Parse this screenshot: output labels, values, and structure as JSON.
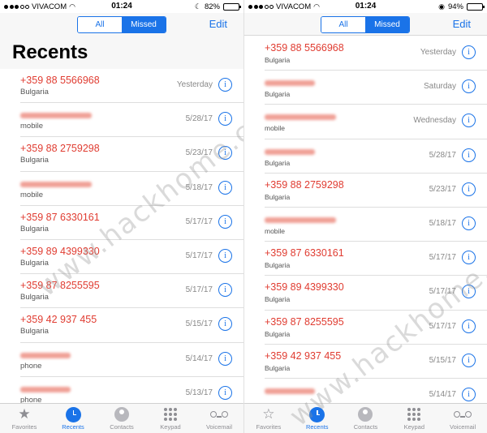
{
  "left": {
    "status": {
      "carrier": "VIVACOM",
      "time": "01:24",
      "battery": "82%"
    },
    "segments": [
      "All",
      "Missed"
    ],
    "edit": "Edit",
    "title": "Recents",
    "calls": [
      {
        "name": "+359 88 5566968",
        "type": "Bulgaria",
        "date": "Yesterday",
        "red": true
      },
      {
        "name": "",
        "type": "mobile",
        "date": "5/28/17",
        "red": false
      },
      {
        "name": "+359 88 2759298",
        "type": "Bulgaria",
        "date": "5/23/17",
        "red": true
      },
      {
        "name": "",
        "type": "mobile",
        "date": "5/18/17",
        "red": false
      },
      {
        "name": "+359 87 6330161",
        "type": "Bulgaria",
        "date": "5/17/17",
        "red": true
      },
      {
        "name": "+359 89 4399330",
        "type": "Bulgaria",
        "date": "5/17/17",
        "red": true
      },
      {
        "name": "+359 87 8255595",
        "type": "Bulgaria",
        "date": "5/17/17",
        "red": true
      },
      {
        "name": "+359 42 937 455",
        "type": "Bulgaria",
        "date": "5/15/17",
        "red": true
      },
      {
        "name": "",
        "type": "phone",
        "date": "5/14/17",
        "red": false
      },
      {
        "name": "",
        "type": "phone",
        "date": "5/13/17",
        "red": false
      }
    ]
  },
  "right": {
    "status": {
      "carrier": "VIVACOM",
      "time": "01:24",
      "battery": "94%"
    },
    "segments": [
      "All",
      "Missed"
    ],
    "edit": "Edit",
    "calls": [
      {
        "name": "+359 88 5566968",
        "type": "Bulgaria",
        "date": "Yesterday",
        "red": true
      },
      {
        "name": "",
        "type": "Bulgaria",
        "date": "Saturday",
        "red": false
      },
      {
        "name": "",
        "type": "mobile",
        "date": "Wednesday",
        "red": false
      },
      {
        "name": "",
        "type": "Bulgaria",
        "date": "5/28/17",
        "red": false
      },
      {
        "name": "+359 88 2759298",
        "type": "Bulgaria",
        "date": "5/23/17",
        "red": true
      },
      {
        "name": "",
        "type": "mobile",
        "date": "5/18/17",
        "red": false
      },
      {
        "name": "+359 87 6330161",
        "type": "Bulgaria",
        "date": "5/17/17",
        "red": true
      },
      {
        "name": "+359 89 4399330",
        "type": "Bulgaria",
        "date": "5/17/17",
        "red": true
      },
      {
        "name": "+359 87 8255595",
        "type": "Bulgaria",
        "date": "5/17/17",
        "red": true
      },
      {
        "name": "+359 42 937 455",
        "type": "Bulgaria",
        "date": "5/15/17",
        "red": true
      },
      {
        "name": "",
        "type": "",
        "date": "5/14/17",
        "red": false
      }
    ]
  },
  "tabs": [
    {
      "label": "Favorites",
      "icon": "star-icon"
    },
    {
      "label": "Recents",
      "icon": "clock-icon"
    },
    {
      "label": "Contacts",
      "icon": "contacts-icon"
    },
    {
      "label": "Keypad",
      "icon": "keypad-icon"
    },
    {
      "label": "Voicemail",
      "icon": "voicemail-icon"
    }
  ],
  "active_tab": "Recents",
  "watermark": "www.hackhome.com",
  "colors": {
    "accent": "#1a73e8",
    "missed": "#e03c31",
    "battery_green": "#4cd964"
  }
}
